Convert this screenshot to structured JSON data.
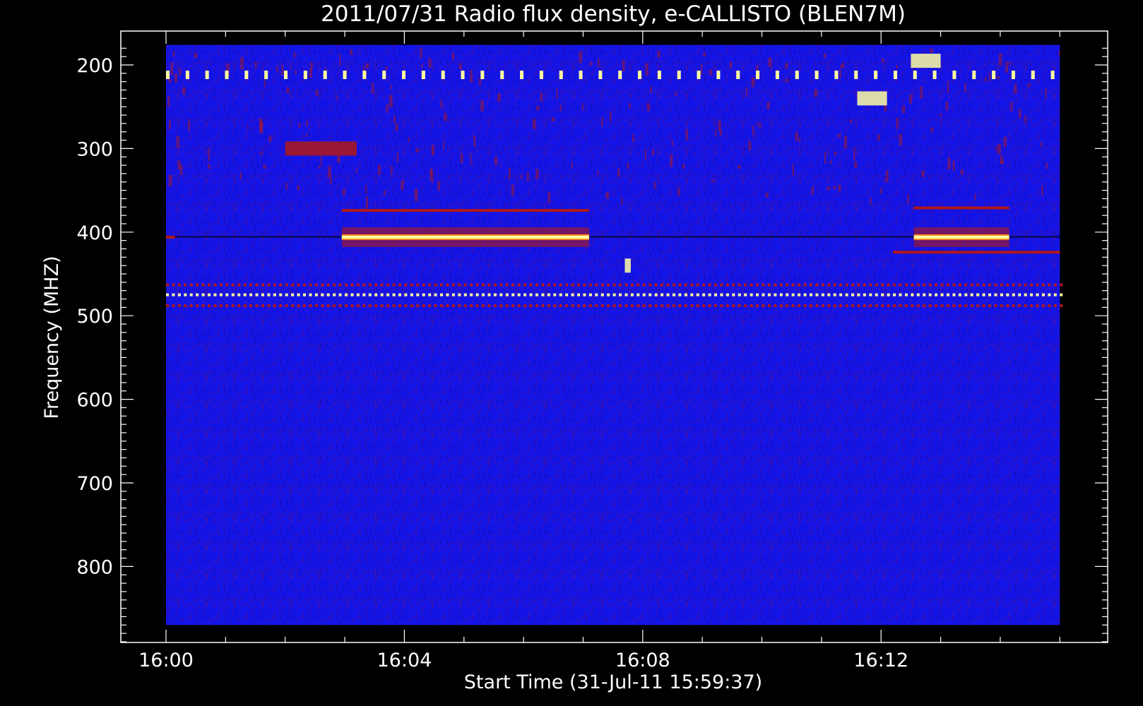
{
  "chart_data": {
    "type": "heatmap",
    "title": "2011/07/31  Radio flux density, e-CALLISTO (BLEN7M)",
    "xlabel": "Start Time (31-Jul-11 15:59:37)",
    "ylabel": "Frequency (MHZ)",
    "x_ticks": [
      "16:00",
      "16:04",
      "16:08",
      "16:12"
    ],
    "x_tick_minutes": [
      0,
      4,
      8,
      12
    ],
    "x_range_minutes": [
      -0.75,
      15.75
    ],
    "y_ticks": [
      200,
      300,
      400,
      500,
      600,
      700,
      800
    ],
    "ylim": [
      176,
      900
    ],
    "y_inverted": true,
    "colormap": {
      "low": "#1010e0",
      "mid": "#b01818",
      "high": "#ffffa0"
    },
    "data_extent_minutes": [
      0,
      15
    ],
    "data_extent_mhz": [
      176,
      870
    ],
    "features": [
      {
        "type": "periodic_bursts",
        "freq_mhz": 211,
        "start_min": 0,
        "end_min": 15,
        "period_min": 0.33,
        "intensity": "high"
      },
      {
        "type": "band",
        "freq_mhz": 406,
        "start_min": 2.95,
        "end_min": 7.1,
        "intensity": "high"
      },
      {
        "type": "band",
        "freq_mhz": 374,
        "start_min": 2.95,
        "end_min": 7.1,
        "intensity": "mid"
      },
      {
        "type": "band",
        "freq_mhz": 406,
        "start_min": 12.55,
        "end_min": 14.15,
        "intensity": "high"
      },
      {
        "type": "band",
        "freq_mhz": 371,
        "start_min": 12.55,
        "end_min": 14.15,
        "intensity": "mid"
      },
      {
        "type": "band",
        "freq_mhz": 424,
        "start_min": 12.2,
        "end_min": 15,
        "intensity": "mid"
      },
      {
        "type": "band",
        "freq_mhz": 406,
        "start_min": 0,
        "end_min": 0.15,
        "intensity": "mid"
      },
      {
        "type": "dotted_band",
        "freq_mhz": 463,
        "start_min": 0,
        "end_min": 15,
        "intensity": "mid"
      },
      {
        "type": "dotted_band",
        "freq_mhz": 475,
        "start_min": 0,
        "end_min": 15,
        "intensity": "high"
      },
      {
        "type": "dotted_band",
        "freq_mhz": 488,
        "start_min": 0,
        "end_min": 15,
        "intensity": "mid"
      },
      {
        "type": "patch",
        "freq_mhz": 440,
        "start_min": 7.7,
        "end_min": 7.8,
        "intensity": "high"
      },
      {
        "type": "patch",
        "freq_mhz": 240,
        "start_min": 11.6,
        "end_min": 12.1,
        "intensity": "high"
      },
      {
        "type": "patch",
        "freq_mhz": 195,
        "start_min": 12.5,
        "end_min": 13.0,
        "intensity": "high"
      },
      {
        "type": "patch",
        "freq_mhz": 300,
        "start_min": 2.0,
        "end_min": 3.2,
        "intensity": "mid"
      }
    ]
  }
}
